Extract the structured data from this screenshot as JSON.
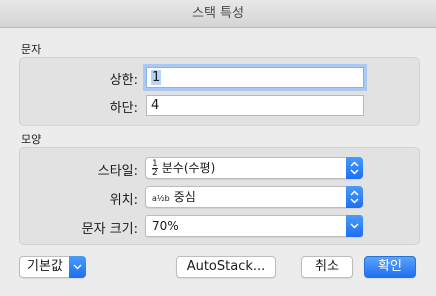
{
  "window": {
    "title": "스택 특성"
  },
  "sections": {
    "text": "문자",
    "shape": "모양"
  },
  "text_group": {
    "upper_label": "상한:",
    "upper_value": "1",
    "lower_label": "하단:",
    "lower_value": "4"
  },
  "shape_group": {
    "style_label": "스타일:",
    "style_glyph_num": "1",
    "style_glyph_den": "2",
    "style_value": "분수(수평)",
    "position_label": "위치:",
    "position_glyph": "a½b",
    "position_value": "중심",
    "size_label": "문자 크기:",
    "size_value": "70%"
  },
  "buttons": {
    "defaults": "기본값",
    "autostack": "AutoStack...",
    "cancel": "취소",
    "ok": "확인"
  },
  "colors": {
    "accent": "#1f6ff0",
    "focus_ring": "#a9c9f4"
  },
  "icons": {
    "popup": "chevron-up-down-icon",
    "dropdown": "chevron-down-icon"
  }
}
